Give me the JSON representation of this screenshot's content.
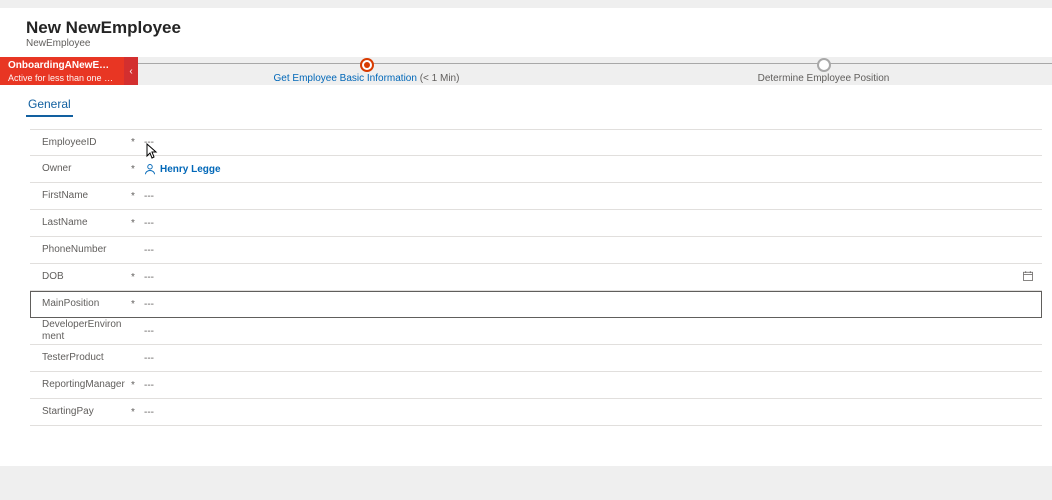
{
  "header": {
    "title": "New NewEmployee",
    "subtitle": "NewEmployee"
  },
  "process": {
    "pill_line1": "OnboardingANewEmplo...",
    "pill_line2": "Active for less than one mi...",
    "steps": [
      {
        "label": "Get Employee Basic Information",
        "time": "(< 1 Min)",
        "active": true
      },
      {
        "label": "Determine Employee Position",
        "time": "",
        "active": false
      }
    ]
  },
  "tabs": [
    {
      "id": "general",
      "label": "General",
      "active": true
    }
  ],
  "form_empty_placeholder": "---",
  "form": [
    {
      "name": "employee-id",
      "label": "EmployeeID",
      "required": true,
      "value": "---",
      "type": "text"
    },
    {
      "name": "owner",
      "label": "Owner",
      "required": true,
      "value": "Henry Legge",
      "type": "entity"
    },
    {
      "name": "first-name",
      "label": "FirstName",
      "required": true,
      "value": "---",
      "type": "text"
    },
    {
      "name": "last-name",
      "label": "LastName",
      "required": true,
      "value": "---",
      "type": "text"
    },
    {
      "name": "phone-number",
      "label": "PhoneNumber",
      "required": false,
      "value": "---",
      "type": "text"
    },
    {
      "name": "dob",
      "label": "DOB",
      "required": true,
      "value": "---",
      "type": "date"
    },
    {
      "name": "main-position",
      "label": "MainPosition",
      "required": true,
      "value": "---",
      "type": "text",
      "selected": true
    },
    {
      "name": "developer-env",
      "label": "DeveloperEnvironment",
      "required": false,
      "value": "---",
      "type": "text"
    },
    {
      "name": "tester-product",
      "label": "TesterProduct",
      "required": false,
      "value": "---",
      "type": "text"
    },
    {
      "name": "reporting-mgr",
      "label": "ReportingManager",
      "required": true,
      "value": "---",
      "type": "text"
    },
    {
      "name": "starting-pay",
      "label": "StartingPay",
      "required": true,
      "value": "---",
      "type": "text"
    }
  ]
}
